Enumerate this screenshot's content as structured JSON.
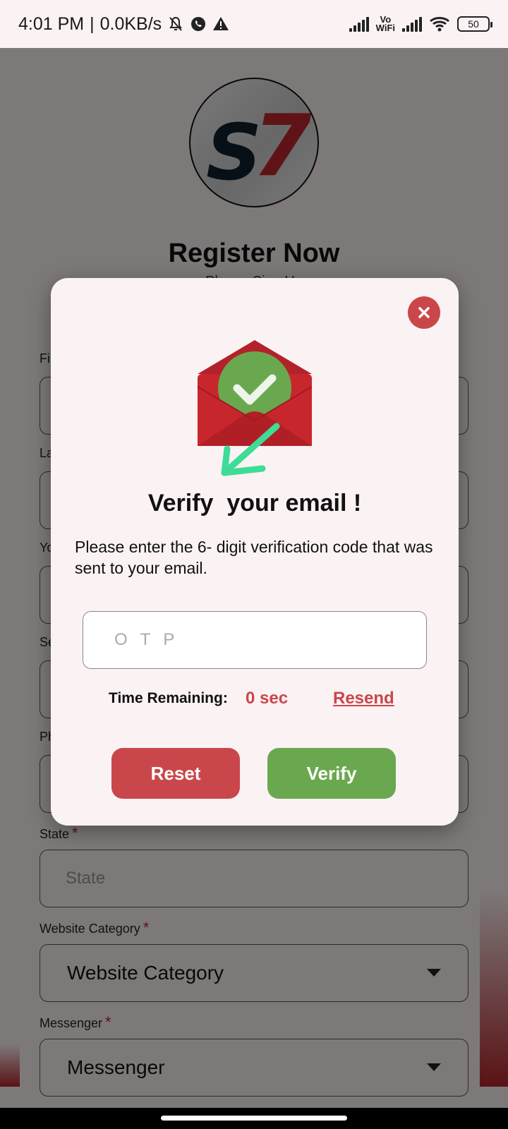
{
  "status_bar": {
    "time": "4:01 PM",
    "separator": "|",
    "speed": "0.0KB/s",
    "vowifi_top": "Vo",
    "vowifi_bottom": "WiFi",
    "battery": "50"
  },
  "app": {
    "title": "Register Now",
    "subtitle": "Please Sign Up",
    "fields": [
      {
        "label": "Fi",
        "placeholder": ""
      },
      {
        "label": "La",
        "placeholder": ""
      },
      {
        "label": "Yo",
        "placeholder": ""
      },
      {
        "label": "Se",
        "placeholder": ""
      },
      {
        "label": "Ph",
        "placeholder": ""
      }
    ],
    "state_label": "State",
    "state_placeholder": "State",
    "website_category_label": "Website Category",
    "website_category_value": "Website Category",
    "messenger_label": "Messenger",
    "messenger_value": "Messenger",
    "required_mark": "*"
  },
  "dialog": {
    "title": "Verify  your email !",
    "message": "Please enter the 6- digit verification code that was sent to your email.",
    "otp_placeholder": "OTP",
    "otp_value": "",
    "timer_label": "Time Remaining:",
    "timer_value": "0 sec",
    "resend_label": "Resend",
    "reset_label": "Reset",
    "verify_label": "Verify"
  },
  "colors": {
    "accent_red": "#c9474b",
    "accent_green": "#6aa84f",
    "brand_red": "#c0272d",
    "arrow_green": "#3ddc97"
  },
  "icons": [
    "mute-bell-icon",
    "whatsapp-icon",
    "warning-icon",
    "signal-icon",
    "wifi-icon",
    "battery-icon",
    "close-icon",
    "email-verified-icon",
    "arrow-icon",
    "dropdown-caret-icon"
  ]
}
